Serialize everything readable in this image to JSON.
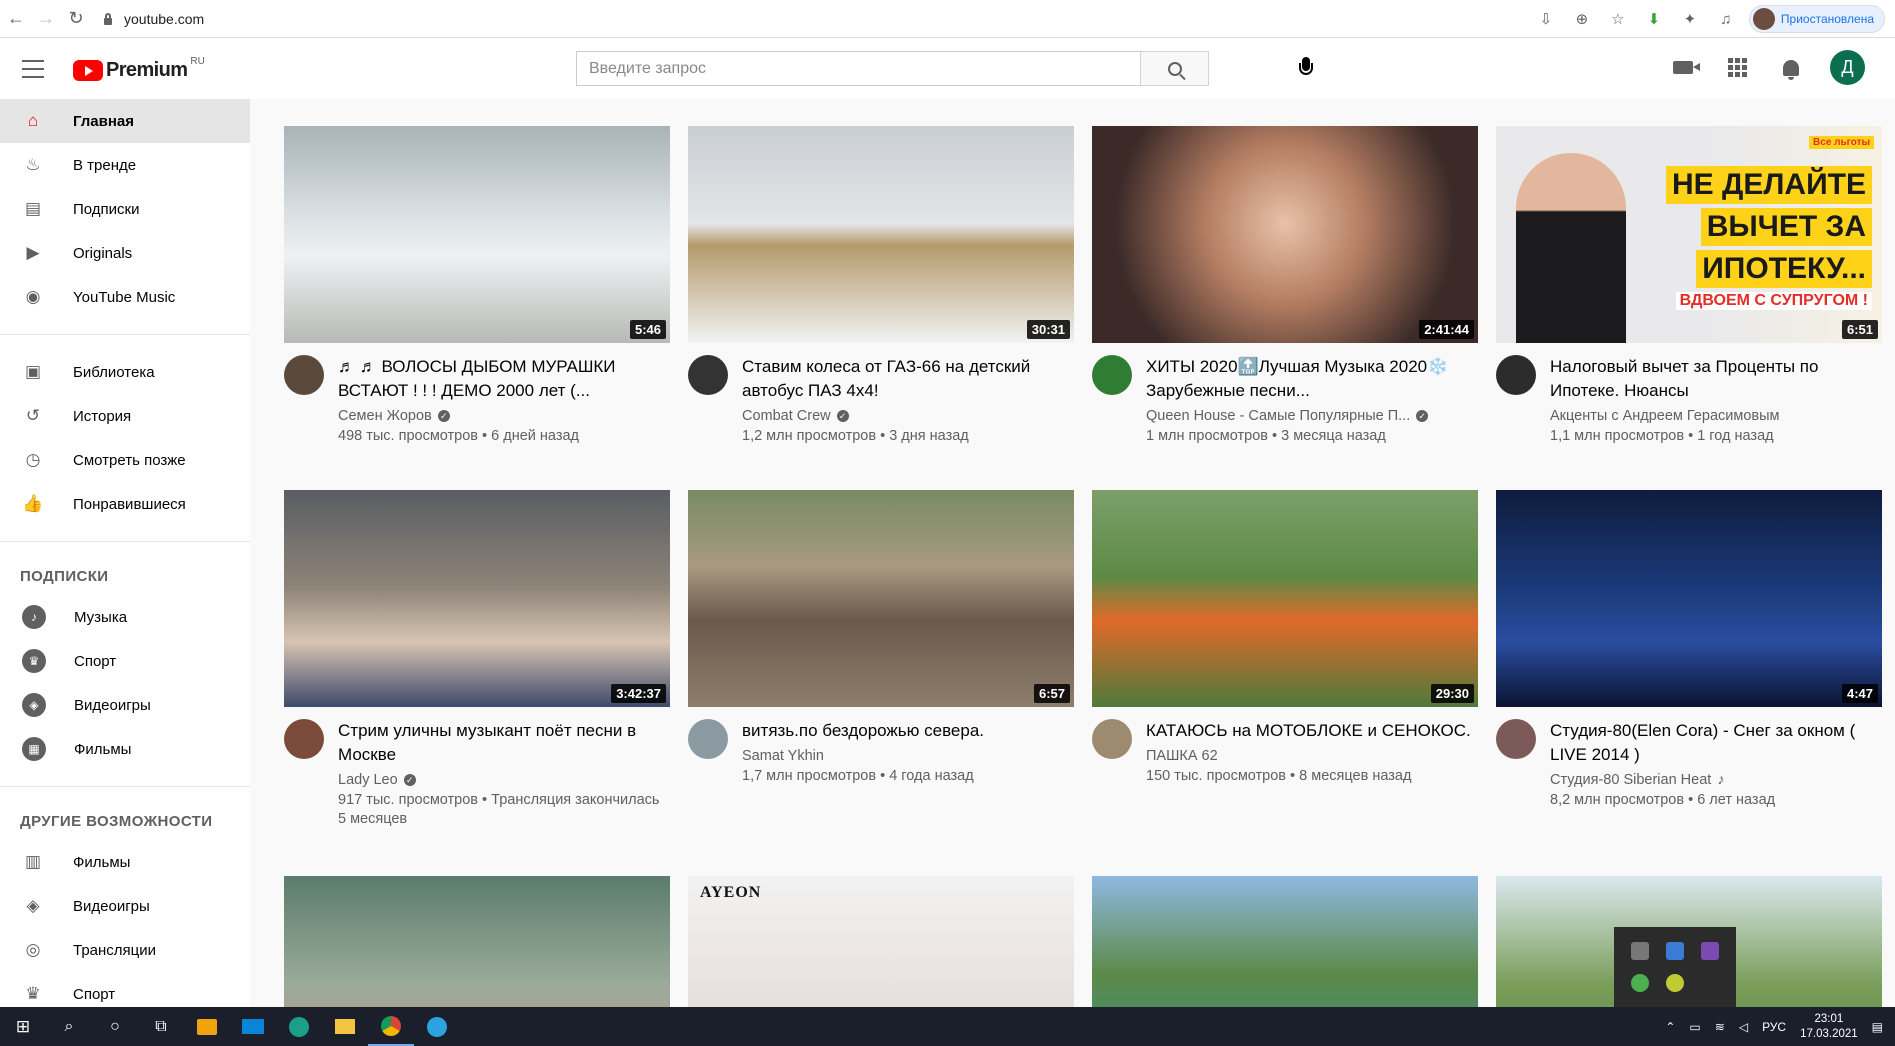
{
  "browser": {
    "url": "youtube.com",
    "profile_label": "Приостановлена"
  },
  "header": {
    "logo_text": "Premium",
    "logo_region": "RU",
    "search_placeholder": "Введите запрос",
    "avatar_letter": "Д"
  },
  "sidebar": {
    "main": [
      {
        "label": "Главная",
        "icon": "home-icon",
        "active": true
      },
      {
        "label": "В тренде",
        "icon": "flame-icon"
      },
      {
        "label": "Подписки",
        "icon": "subscriptions-icon"
      },
      {
        "label": "Originals",
        "icon": "originals-icon"
      },
      {
        "label": "YouTube Music",
        "icon": "music-icon"
      }
    ],
    "library": [
      {
        "label": "Библиотека",
        "icon": "library-icon"
      },
      {
        "label": "История",
        "icon": "history-icon"
      },
      {
        "label": "Смотреть позже",
        "icon": "clock-icon"
      },
      {
        "label": "Понравившиеся",
        "icon": "thumbs-up-icon"
      }
    ],
    "subs_heading": "ПОДПИСКИ",
    "subs": [
      {
        "label": "Музыка",
        "icon": "music-note-icon"
      },
      {
        "label": "Спорт",
        "icon": "trophy-icon"
      },
      {
        "label": "Видеоигры",
        "icon": "gamepad-icon"
      },
      {
        "label": "Фильмы",
        "icon": "film-icon"
      }
    ],
    "more_heading": "ДРУГИЕ ВОЗМОЖНОСТИ",
    "more": [
      {
        "label": "Фильмы",
        "icon": "film-strip-icon"
      },
      {
        "label": "Видеоигры",
        "icon": "gamepad-icon"
      },
      {
        "label": "Трансляции",
        "icon": "live-icon"
      },
      {
        "label": "Спорт",
        "icon": "trophy-icon"
      }
    ]
  },
  "videos": [
    {
      "title": "♬ ♬ ВОЛОСЫ ДЫБОМ МУРАШКИ ВСТАЮТ ! ! ! ДЕМО 2000 лет (...",
      "channel": "Семен Жоров",
      "verified": true,
      "views": "498 тыс. просмотров",
      "age": "6 дней назад",
      "duration": "5:46"
    },
    {
      "title": "Ставим колеса от ГАЗ-66 на детский автобус ПАЗ 4х4!",
      "channel": "Combat Crew",
      "verified": true,
      "views": "1,2 млн просмотров",
      "age": "3 дня назад",
      "duration": "30:31"
    },
    {
      "title": "ХИТЫ 2020🔝Лучшая Музыка 2020❄️ Зарубежные песни...",
      "channel": "Queen House - Самые Популярные П...",
      "verified": true,
      "views": "1 млн просмотров",
      "age": "3 месяца назад",
      "duration": "2:41:44"
    },
    {
      "title": "Налоговый вычет за Проценты по Ипотеке. Нюансы",
      "channel": "Акценты с Андреем Герасимовым",
      "verified": false,
      "views": "1,1 млн просмотров",
      "age": "1 год назад",
      "duration": "6:51"
    },
    {
      "title": "Стрим уличны музыкант поёт песни в Москве",
      "channel": "Lady Leo",
      "verified": true,
      "views": "917 тыс. просмотров",
      "age": "Трансляция закончилась 5 месяцев",
      "duration": "3:42:37"
    },
    {
      "title": "витязь.по бездорожью севера.",
      "channel": "Samat Ykhin",
      "verified": false,
      "views": "1,7 млн просмотров",
      "age": "4 года назад",
      "duration": "6:57"
    },
    {
      "title": "КАТАЮСЬ на МОТОБЛОКЕ и СЕНОКОС.",
      "channel": "ПАШКА 62",
      "verified": false,
      "views": "150 тыс. просмотров",
      "age": "8 месяцев назад",
      "duration": "29:30"
    },
    {
      "title": "Студия-80(Elen Cora) - Снег за окном ( LIVE 2014 )",
      "channel": "Студия-80 Siberian Heat",
      "verified": false,
      "music_note": "♪",
      "views": "8,2 млн просмотров",
      "age": "6 лет назад",
      "duration": "4:47"
    }
  ],
  "thumb4_overlay": {
    "lines": [
      "НЕ ДЕЛАЙТЕ",
      "ВЫЧЕТ ЗА",
      "ИПОТЕКУ..."
    ],
    "sub": "ВДВОЕМ С СУПРУГОМ !",
    "badge": "Все льготы"
  },
  "thumb10_overlay": "AYEON",
  "taskbar": {
    "lang": "РУС",
    "time": "23:01",
    "date": "17.03.2021"
  },
  "colors": {
    "brand_red": "#ff0000",
    "avatar_green": "#0b6e4f",
    "taskbar": "#1a1f2b"
  }
}
